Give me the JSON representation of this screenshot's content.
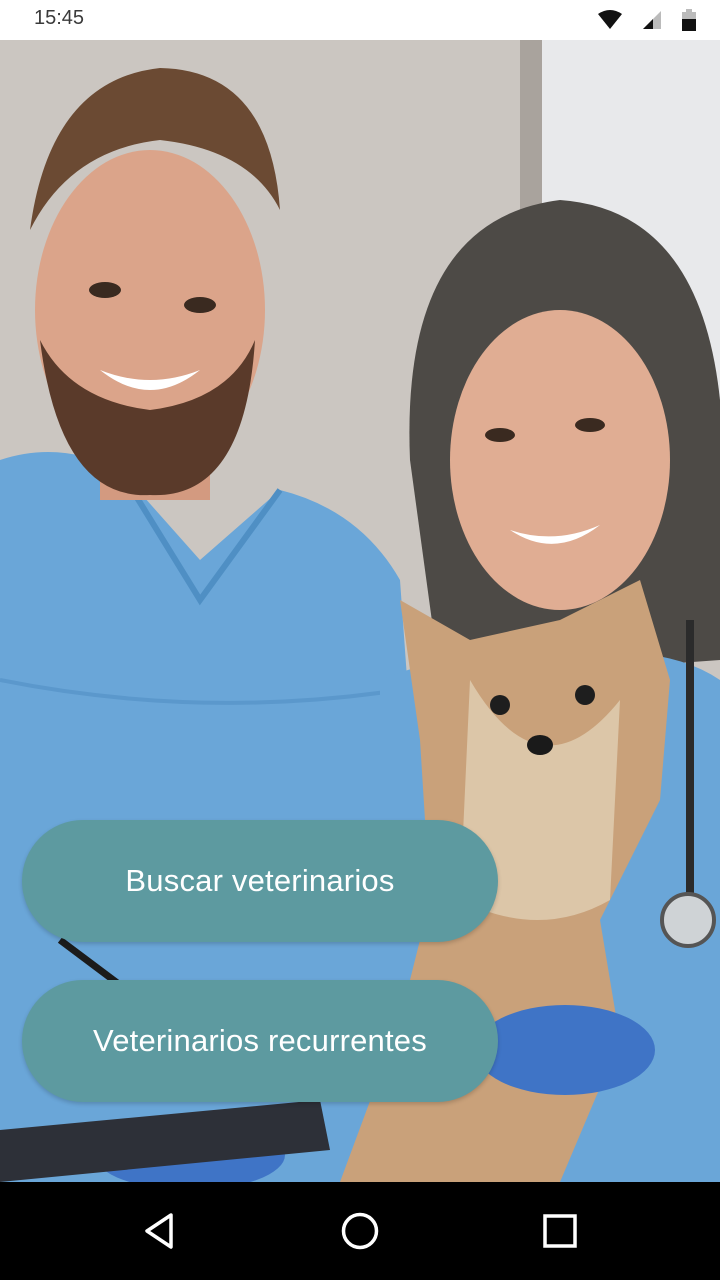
{
  "status_bar": {
    "time": "15:45",
    "icons": [
      "wifi-icon",
      "signal-icon",
      "battery-icon"
    ]
  },
  "hero": {
    "image": "veterinarians-with-yorkshire-terrier-photo"
  },
  "actions": {
    "search_label": "Buscar veterinarios",
    "recurrent_label": "Veterinarios recurrentes"
  },
  "nav_bar": {
    "icons": [
      "back-icon",
      "home-icon",
      "recents-icon"
    ]
  },
  "colors": {
    "button": "#5d9aa0",
    "button_text": "#ffffff",
    "status_bar": "#ffffff",
    "nav_bar": "#000000"
  }
}
